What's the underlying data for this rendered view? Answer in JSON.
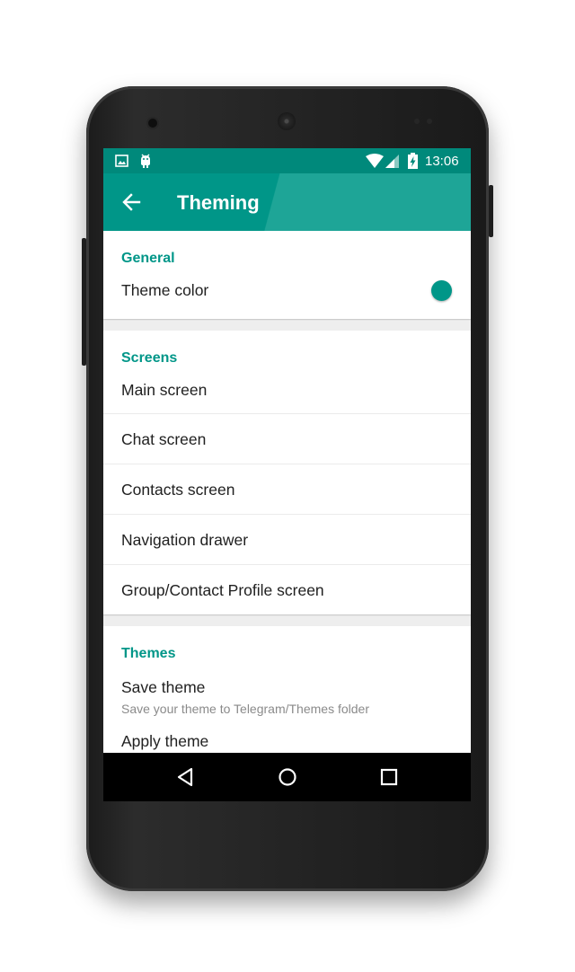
{
  "status_bar": {
    "time": "13:06",
    "left_icons": [
      "image-icon",
      "android-debug-icon"
    ],
    "right_icons": [
      "wifi-icon",
      "cell-signal-icon",
      "battery-charging-icon"
    ]
  },
  "toolbar": {
    "title": "Theming",
    "back_icon": "arrow-back-icon"
  },
  "sections": {
    "general": {
      "header": "General",
      "theme_color_label": "Theme color",
      "theme_color_value": "#009688"
    },
    "screens": {
      "header": "Screens",
      "items": [
        {
          "label": "Main screen"
        },
        {
          "label": "Chat screen"
        },
        {
          "label": "Contacts screen"
        },
        {
          "label": "Navigation drawer"
        },
        {
          "label": "Group/Contact Profile screen"
        }
      ]
    },
    "themes": {
      "header": "Themes",
      "save_theme_title": "Save theme",
      "save_theme_summary": "Save your theme to Telegram/Themes folder",
      "next_item_partial": "Apply theme"
    }
  },
  "nav_bar": {
    "icons": [
      "back-triangle-icon",
      "home-circle-icon",
      "recents-square-icon"
    ]
  },
  "colors": {
    "primary": "#009688",
    "primary_dark": "#00897b",
    "accent": "#009688"
  }
}
